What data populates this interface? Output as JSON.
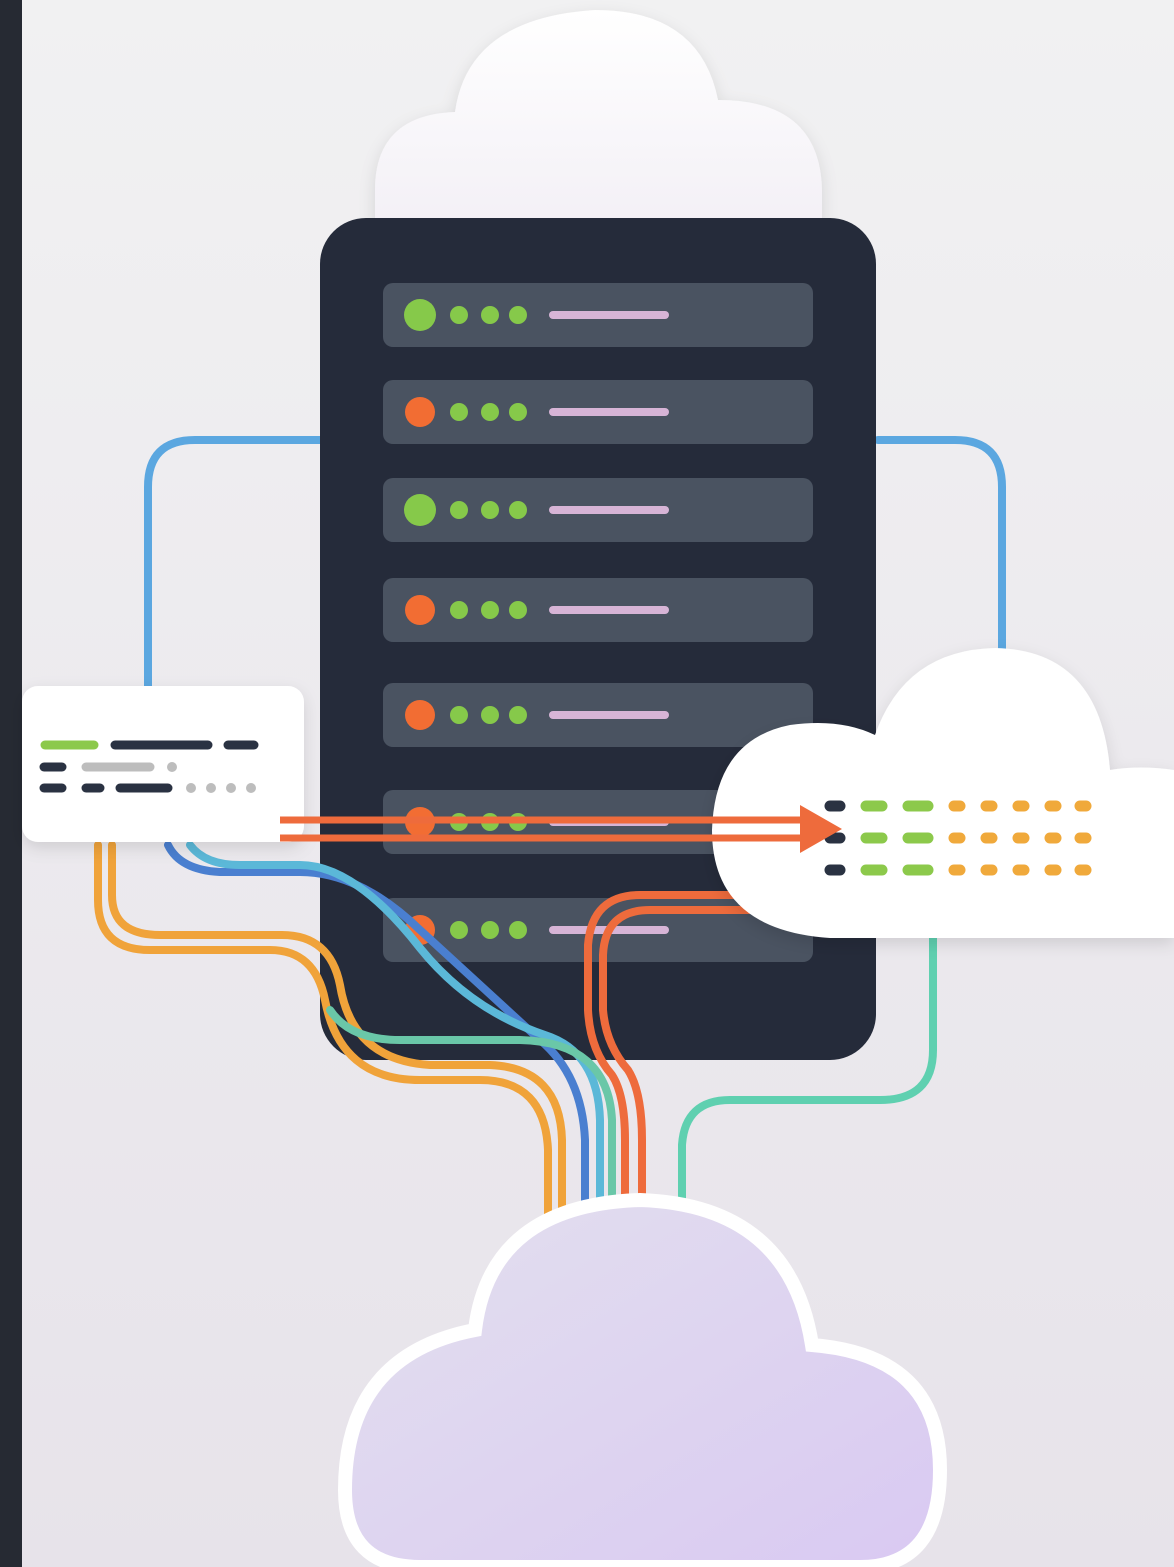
{
  "colors": {
    "background_top": "#f0f0f1",
    "background_bottom": "#e8e4ea",
    "left_strip": "#262a33",
    "rack": "#252b3a",
    "slot": "#4a5361",
    "status_green": "#86c94a",
    "status_orange": "#f26d33",
    "slot_label": "#d7b4d6",
    "cable_blue": "#5ba7e0",
    "cable_blue_dark": "#4a7fd0",
    "cable_orange": "#f0a33a",
    "cable_red": "#ee6b3c",
    "cable_teal": "#5fd0b0",
    "cloud": "#ffffff",
    "cloud_bottom_fill": "#ddd2f0",
    "card": "#ffffff",
    "dash_dark": "#2a3242",
    "dash_green": "#8cc94b",
    "dash_gray": "#bdbdbd",
    "dash_amber": "#f0a93a"
  },
  "icons": {
    "top_cloud": "cloud-icon",
    "right_cloud": "cloud-icon",
    "bottom_cloud": "cloud-icon",
    "server": "server-rack-icon",
    "data_card": "data-card-icon",
    "transfer_arrow": "arrow-right-icon"
  },
  "server_slots": [
    {
      "status": "green"
    },
    {
      "status": "orange"
    },
    {
      "status": "green"
    },
    {
      "status": "orange"
    },
    {
      "status": "orange"
    },
    {
      "status": "orange"
    },
    {
      "status": "orange"
    }
  ]
}
